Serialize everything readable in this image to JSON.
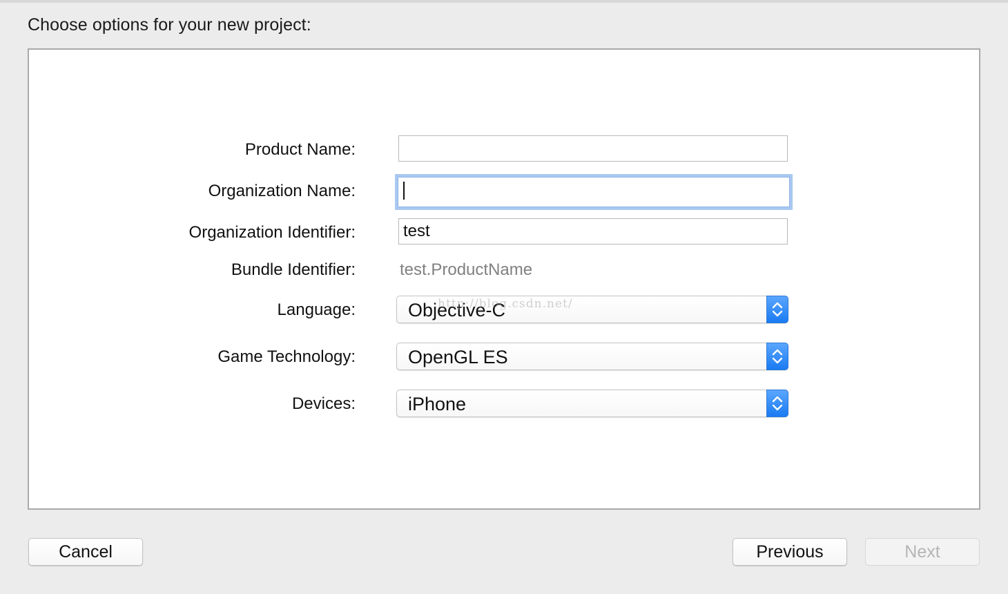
{
  "title": "Choose options for your new project:",
  "fields": {
    "product_name": {
      "label": "Product Name:",
      "value": ""
    },
    "organization_name": {
      "label": "Organization Name:",
      "value": ""
    },
    "organization_identifier": {
      "label": "Organization Identifier:",
      "value": "test"
    },
    "bundle_identifier": {
      "label": "Bundle Identifier:",
      "value": "test.ProductName"
    }
  },
  "popups": {
    "language": {
      "label": "Language:",
      "selected": "Objective-C"
    },
    "game_technology": {
      "label": "Game Technology:",
      "selected": "OpenGL ES"
    },
    "devices": {
      "label": "Devices:",
      "selected": "iPhone"
    }
  },
  "watermark": "http://blog.csdn.net/",
  "buttons": {
    "cancel": "Cancel",
    "previous": "Previous",
    "next": "Next"
  },
  "colors": {
    "accent": "#1a7bf2",
    "focus_ring": "#a9c8f2",
    "window_bg": "#ececec"
  }
}
